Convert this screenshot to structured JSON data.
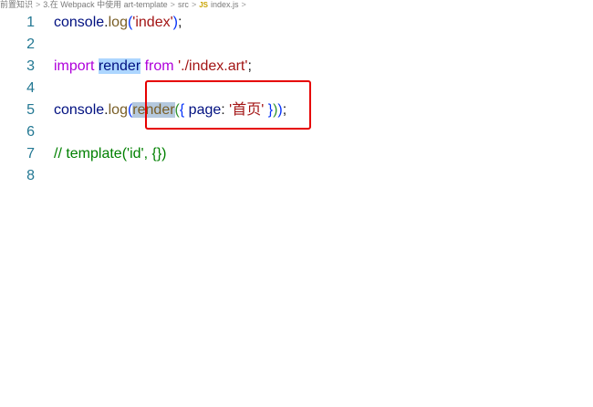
{
  "breadcrumb": {
    "items": [
      "前置知识",
      "3.在 Webpack 中使用 art-template",
      "src",
      "index.js"
    ],
    "file_badge": "JS",
    "separator": ">"
  },
  "editor": {
    "lines": [
      {
        "number": "1",
        "tokens": [
          {
            "text": "console",
            "type": "default"
          },
          {
            "text": ".",
            "type": "plain"
          },
          {
            "text": "log",
            "type": "func"
          },
          {
            "text": "(",
            "type": "paren"
          },
          {
            "text": "'index'",
            "type": "string"
          },
          {
            "text": ")",
            "type": "paren"
          },
          {
            "text": ";",
            "type": "plain"
          }
        ]
      },
      {
        "number": "2",
        "tokens": []
      },
      {
        "number": "3",
        "tokens": [
          {
            "text": "import",
            "type": "keyword"
          },
          {
            "text": " ",
            "type": "plain"
          },
          {
            "text": "render",
            "type": "default",
            "highlight": "select"
          },
          {
            "text": " ",
            "type": "plain"
          },
          {
            "text": "from",
            "type": "keyword"
          },
          {
            "text": " ",
            "type": "plain"
          },
          {
            "text": "'./index.art'",
            "type": "string"
          },
          {
            "text": ";",
            "type": "plain"
          }
        ]
      },
      {
        "number": "4",
        "tokens": []
      },
      {
        "number": "5",
        "tokens": [
          {
            "text": "console",
            "type": "default"
          },
          {
            "text": ".",
            "type": "plain"
          },
          {
            "text": "log",
            "type": "func"
          },
          {
            "text": "(",
            "type": "paren"
          },
          {
            "text": "render",
            "type": "func",
            "highlight": "cursor"
          },
          {
            "text": "(",
            "type": "brace"
          },
          {
            "text": "{",
            "type": "paren"
          },
          {
            "text": " ",
            "type": "plain"
          },
          {
            "text": "page",
            "type": "default"
          },
          {
            "text": ": ",
            "type": "plain"
          },
          {
            "text": "'首页'",
            "type": "string"
          },
          {
            "text": " ",
            "type": "plain"
          },
          {
            "text": "}",
            "type": "paren"
          },
          {
            "text": ")",
            "type": "brace"
          },
          {
            "text": ")",
            "type": "paren"
          },
          {
            "text": ";",
            "type": "plain"
          }
        ]
      },
      {
        "number": "6",
        "tokens": []
      },
      {
        "number": "7",
        "tokens": [
          {
            "text": "// template('id', {})",
            "type": "comment"
          }
        ]
      },
      {
        "number": "8",
        "tokens": []
      }
    ]
  },
  "colors": {
    "annotation_box": "#e60000",
    "line_number": "#237893",
    "selection": "#add6ff"
  }
}
